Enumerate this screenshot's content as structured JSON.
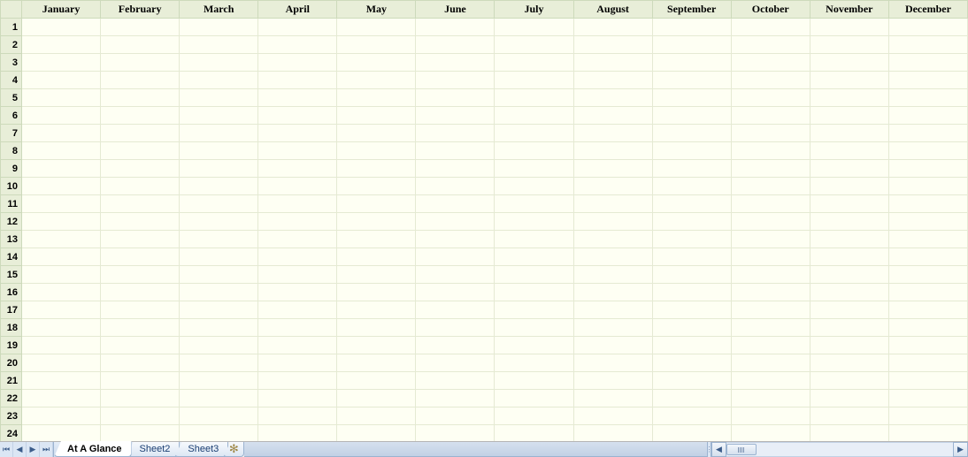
{
  "columns": [
    "January",
    "February",
    "March",
    "April",
    "May",
    "June",
    "July",
    "August",
    "September",
    "October",
    "November",
    "December"
  ],
  "rows": [
    1,
    2,
    3,
    4,
    5,
    6,
    7,
    8,
    9,
    10,
    11,
    12,
    13,
    14,
    15,
    16,
    17,
    18,
    19,
    20,
    21,
    22,
    23,
    24
  ],
  "tabs": [
    {
      "label": "At A Glance",
      "active": true
    },
    {
      "label": "Sheet2",
      "active": false
    },
    {
      "label": "Sheet3",
      "active": false
    }
  ]
}
